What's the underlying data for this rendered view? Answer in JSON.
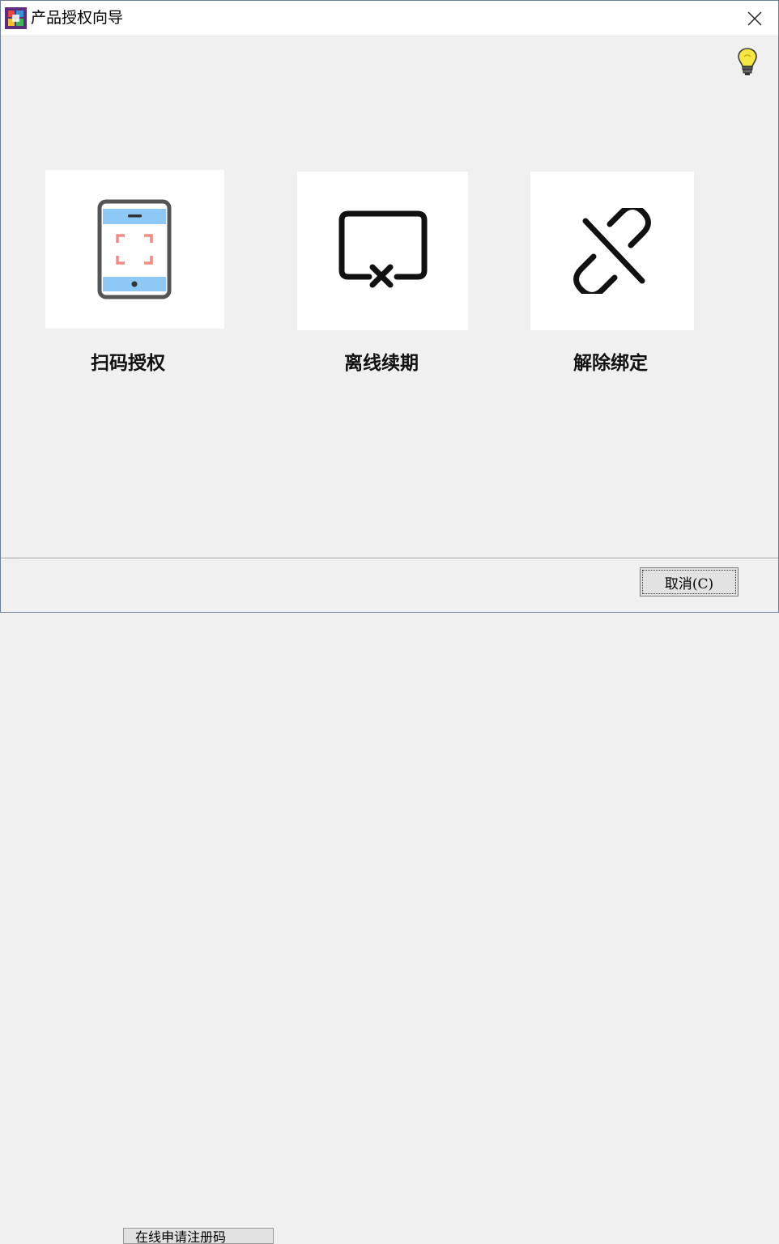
{
  "window": {
    "title": "产品授权向导"
  },
  "icons": {
    "app": "app-logo-icon",
    "close": "close-icon",
    "help": "lightbulb-icon",
    "scan": "tablet-scan-icon",
    "offline": "screen-x-icon",
    "unbind": "broken-link-icon"
  },
  "options": [
    {
      "label": "扫码授权"
    },
    {
      "label": "离线续期"
    },
    {
      "label": "解除绑定"
    }
  ],
  "footer": {
    "cancel_label": "取消(C)"
  },
  "background_window": {
    "tab_label": "在线申请注册码"
  },
  "colors": {
    "window_bg": "#f0f0f0",
    "card_bg": "#ffffff",
    "scan_frame": "#f28b82",
    "tablet_band": "#8ec8f4",
    "icon_stroke": "#111111",
    "bulb": "#f5e642"
  }
}
